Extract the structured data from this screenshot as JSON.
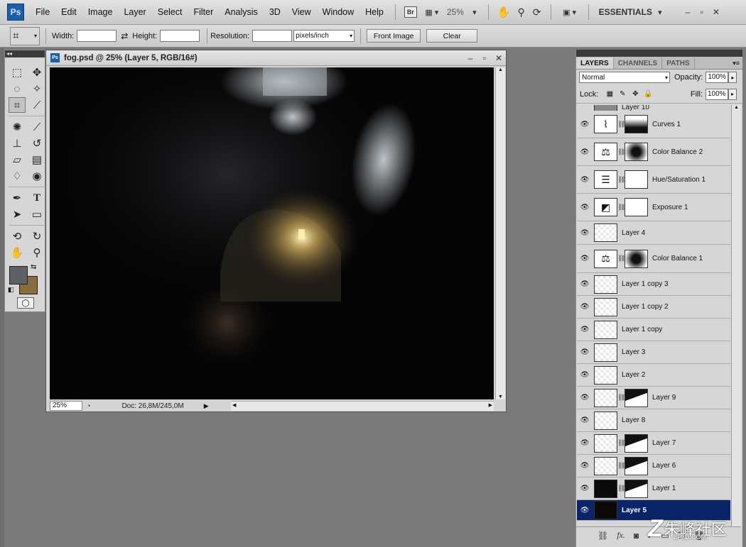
{
  "app": {
    "logo": "Ps",
    "workspace": "ESSENTIALS",
    "zoom": "25%",
    "bridge": "Br"
  },
  "menu": [
    "File",
    "Edit",
    "Image",
    "Layer",
    "Select",
    "Filter",
    "Analysis",
    "3D",
    "View",
    "Window",
    "Help"
  ],
  "options": {
    "width_label": "Width:",
    "width_value": "",
    "height_label": "Height:",
    "height_value": "",
    "resolution_label": "Resolution:",
    "resolution_value": "",
    "units": "pixels/inch",
    "front_image": "Front Image",
    "clear": "Clear"
  },
  "document": {
    "title": "fog.psd @ 25% (Layer 5, RGB/16#)",
    "zoom": "25%",
    "doc_info": "Doc: 26,8M/245,0M"
  },
  "colors": {
    "foreground": "#5f6068",
    "background": "#8b6a3e",
    "selected_row": "#0a246a"
  },
  "layers_panel": {
    "tabs": [
      "LAYERS",
      "CHANNELS",
      "PATHS"
    ],
    "blend_mode": "Normal",
    "opacity_label": "Opacity:",
    "opacity": "100%",
    "lock_label": "Lock:",
    "fill_label": "Fill:",
    "fill": "100%",
    "layers": [
      {
        "name": "Layer 10",
        "thumb": "gray",
        "mask": false
      },
      {
        "name": "Curves 1",
        "thumb": "curves-icon",
        "mask": true
      },
      {
        "name": "Color Balance 2",
        "thumb": "balance-icon",
        "mask": true
      },
      {
        "name": "Hue/Saturation 1",
        "thumb": "huesat-icon",
        "mask": true
      },
      {
        "name": "Exposure 1",
        "thumb": "exposure-icon",
        "mask": true
      },
      {
        "name": "Layer 4",
        "thumb": "transparent",
        "mask": false
      },
      {
        "name": "Color Balance 1",
        "thumb": "balance-icon",
        "mask": true
      },
      {
        "name": "Layer 1 copy 3",
        "thumb": "transparent",
        "mask": false
      },
      {
        "name": "Layer 1 copy 2",
        "thumb": "transparent",
        "mask": false
      },
      {
        "name": "Layer 1 copy",
        "thumb": "transparent",
        "mask": false
      },
      {
        "name": "Layer 3",
        "thumb": "transparent",
        "mask": false
      },
      {
        "name": "Layer 2",
        "thumb": "transparent",
        "mask": false
      },
      {
        "name": "Layer 9",
        "thumb": "transparent",
        "mask": true
      },
      {
        "name": "Layer 8",
        "thumb": "transparent",
        "mask": false
      },
      {
        "name": "Layer 7",
        "thumb": "transparent",
        "mask": true
      },
      {
        "name": "Layer 6",
        "thumb": "transparent",
        "mask": true
      },
      {
        "name": "Layer 1",
        "thumb": "dark",
        "mask": true
      },
      {
        "name": "Layer 5",
        "thumb": "dark",
        "mask": false,
        "selected": true
      }
    ]
  },
  "watermark": {
    "brand": "朱峰社区",
    "url": "ZF3D.COM"
  }
}
